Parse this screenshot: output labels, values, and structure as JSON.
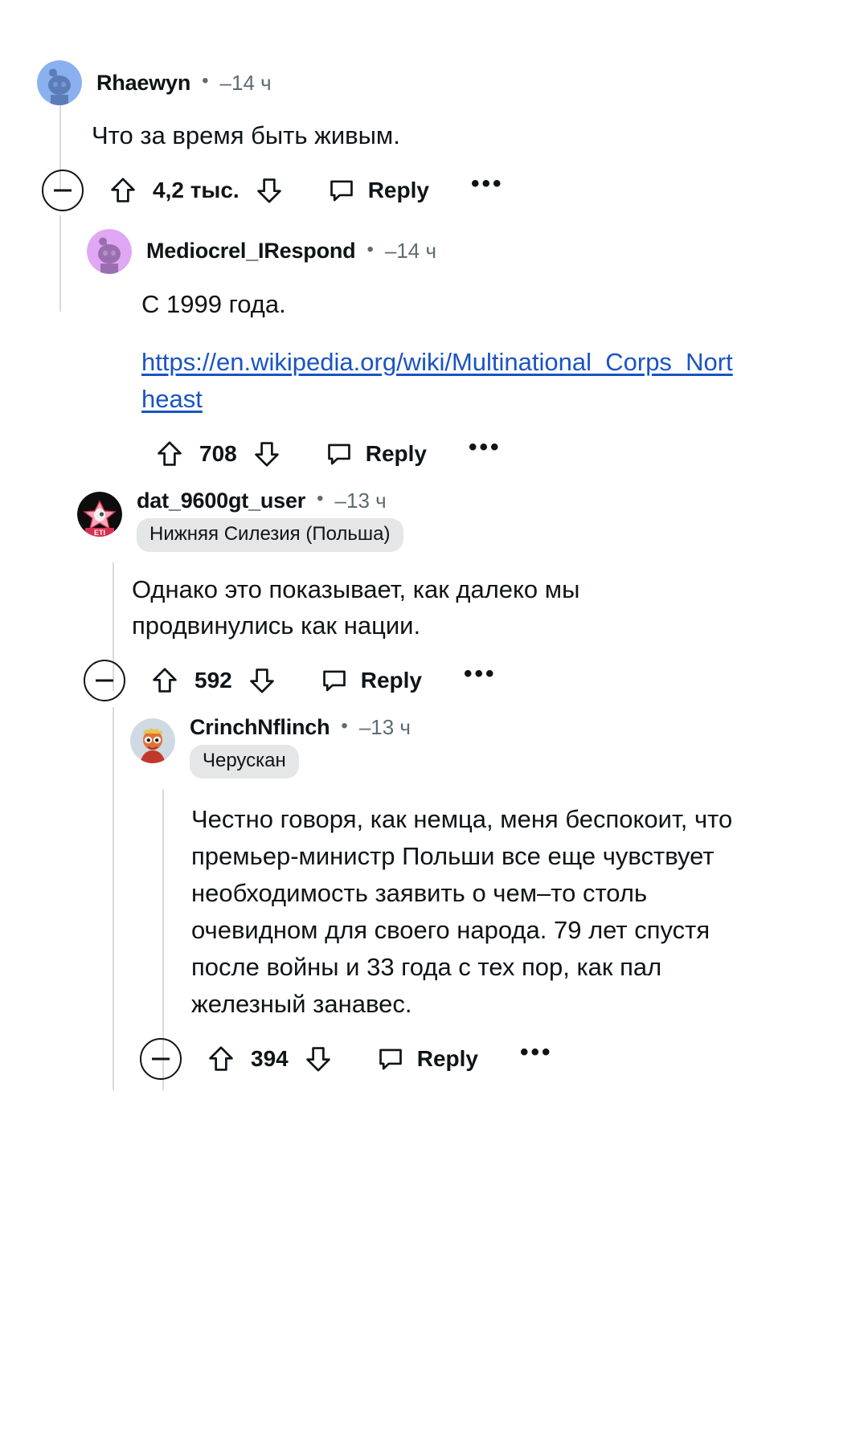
{
  "thread": {
    "comments": [
      {
        "id": "c1",
        "username": "Rhaewyn",
        "separator": "•",
        "timestamp": "–14 ч",
        "flair": null,
        "avatar_kind": "reddit-snoo-blue",
        "body": [
          "Что за время быть живым."
        ],
        "link": null,
        "vote_count": "4,2 тыс.",
        "reply_label": "Reply",
        "more_label": "•••",
        "has_collapse": true
      },
      {
        "id": "c2",
        "username": "Mediocrel_IRespond",
        "separator": "•",
        "timestamp": "–14 ч",
        "flair": null,
        "avatar_kind": "reddit-snoo-purple",
        "body": [
          "С 1999 года."
        ],
        "link": "https://en.wikipedia.org/wiki/Multinational_Corps_Northeast",
        "vote_count": "708",
        "reply_label": "Reply",
        "more_label": "•••",
        "has_collapse": false
      },
      {
        "id": "c3",
        "username": "dat_9600gt_user",
        "separator": "•",
        "timestamp": "–13 ч",
        "flair": "Нижняя Силезия (Польша)",
        "avatar_kind": "eti-cat-dark",
        "body": [
          "Однако это показывает, как далеко мы продвинулись как нации."
        ],
        "link": null,
        "vote_count": "592",
        "reply_label": "Reply",
        "more_label": "•••",
        "has_collapse": true
      },
      {
        "id": "c4",
        "username": "CrinchNflinch",
        "separator": "•",
        "timestamp": "–13 ч",
        "flair": "Черускан",
        "avatar_kind": "cartoon-character-orange",
        "body": [
          "Честно говоря, как немца, меня беспокоит, что премьер-министр Польши все еще чувствует необходимость заявить о чем–то столь очевидном для своего народа. 79 лет спустя после войны и 33 года с тех пор, как пал железный занавес."
        ],
        "link": null,
        "vote_count": "394",
        "reply_label": "Reply",
        "more_label": "•••",
        "has_collapse": true
      }
    ]
  },
  "icons": {
    "collapse": "minus-circle-icon",
    "upvote": "upvote-arrow-icon",
    "downvote": "downvote-arrow-icon",
    "reply": "comment-bubble-icon",
    "more": "overflow-menu-icon"
  },
  "colors": {
    "link": "#1a53c4",
    "text": "#0f1417",
    "muted": "#5c6c74",
    "flair_bg": "#e4e6e7",
    "rail": "#d8dade",
    "avatar_blue": "#8ab0f0",
    "avatar_purple": "#e0a7f5"
  }
}
